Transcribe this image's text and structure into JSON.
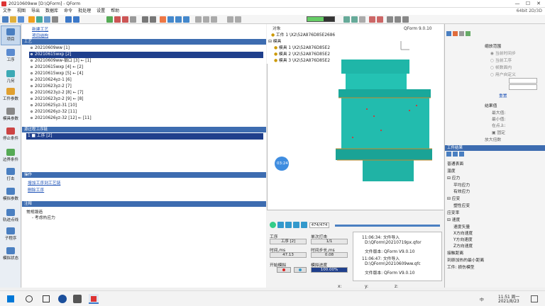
{
  "titlebar": {
    "title": "20210609ww  [D:\\QForm]  - QForm",
    "min": "—",
    "max": "☐",
    "close": "✕"
  },
  "menubar": {
    "items": [
      "文件",
      "视图",
      "导出",
      "数据库",
      "命令",
      "批处理",
      "设置",
      "帮助"
    ],
    "right": "64bit 2D/3D"
  },
  "leftstrip": {
    "items": [
      "项目",
      "工序",
      "几何",
      "工件参数",
      "模具参数",
      "停止条件",
      "边界条件",
      "打击",
      "模拟参数",
      "轨迹点线",
      "子程序",
      "模拟状态"
    ]
  },
  "leftpanel": {
    "links": [
      "新建工艺",
      "项目结构"
    ],
    "section_process": "工艺",
    "rows": [
      "20210609ww [1]",
      "20210615wxp [2]",
      "20210609ww-锻口 [3] ← [1]",
      "20210615wxp [4] ← [2]",
      "20210615wxp [5] ← [4]",
      "20210624yz-1 [6]",
      "20210623yz-2 [7]",
      "20210623yz-2 [8] ← [7]",
      "20210623yz-2 [9] ← [8]",
      "20210625yz-31 [10]",
      "20210626yz-32 [11]",
      "20210626yz-32 [12] ← [11]"
    ],
    "section_ops": "源过程工序链",
    "op_row": "1  ■ 工序 [2]",
    "section_actions": "操作",
    "actions": [
      "增加工序到工艺链",
      "删除工序"
    ],
    "section_notes": "注释",
    "notes": [
      "常规锻造",
      "- 考虑热应力"
    ]
  },
  "objects": {
    "header": "对象",
    "items": [
      "工件 1 \\X2\\52A876D85E2686",
      "模具",
      "模具 1 \\X2\\52A876D85E2",
      "模具 2 \\X2\\52A876D85E2",
      "模具 3 \\X2\\52A876D85E2"
    ]
  },
  "viewport": {
    "version": "QForm 9.0.10",
    "time_badge": "03:24",
    "slider_start": "0"
  },
  "bottom": {
    "frame": "474/474",
    "lbl_operation": "工序",
    "operation_value": "工序 [2]",
    "lbl_blow": "单次打击",
    "blow_value": "1/1",
    "lbl_time": "时间,ms",
    "time_value": "47.13",
    "lbl_timestep": "时间步长,ms",
    "timestep_value": "0.08",
    "lbl_start": "开始模拟",
    "lbl_progress": "模拟进度",
    "progress_value": "100.00%",
    "log": [
      "11:06:34: 文件导入",
      "D:\\QForm\\20210719px.qfor",
      "文件版本: QForm V9.0.10",
      "11:06:47: 文件导入",
      "D:\\QForm\\20210609ww.qfc",
      "文件版本: QForm V9.0.10"
    ],
    "coords": [
      "x:",
      "y:",
      "z:"
    ]
  },
  "rightpanel": {
    "scale_title": "缩放范围",
    "radio": [
      "当前时间步",
      "当前工序",
      "帧数面内",
      "用户自定义"
    ],
    "reset": "重置",
    "result_title": "结果值",
    "result_labels": [
      "最大值:",
      "最小值:",
      "在点上:"
    ],
    "fix": "固定",
    "zoom": "放大倍数",
    "fields_title": "工件结果",
    "fields": [
      "普通表面",
      "温度",
      "应力",
      "平均应力",
      "有效应力",
      "应变",
      "塑性应变",
      "应变率",
      "速度",
      "速度矢量",
      "X方向速度",
      "Y方向速度",
      "Z方向速度",
      "接触距离",
      "到原加热的最小距离",
      "工件: 损伤模型"
    ]
  },
  "taskbar": {
    "time": "11:51 周一",
    "date": "2021/8/23",
    "lang": "中"
  },
  "colors": {
    "accent": "#3d6cb0",
    "selection": "#1f3f8c",
    "part": "#1fb6a8"
  }
}
